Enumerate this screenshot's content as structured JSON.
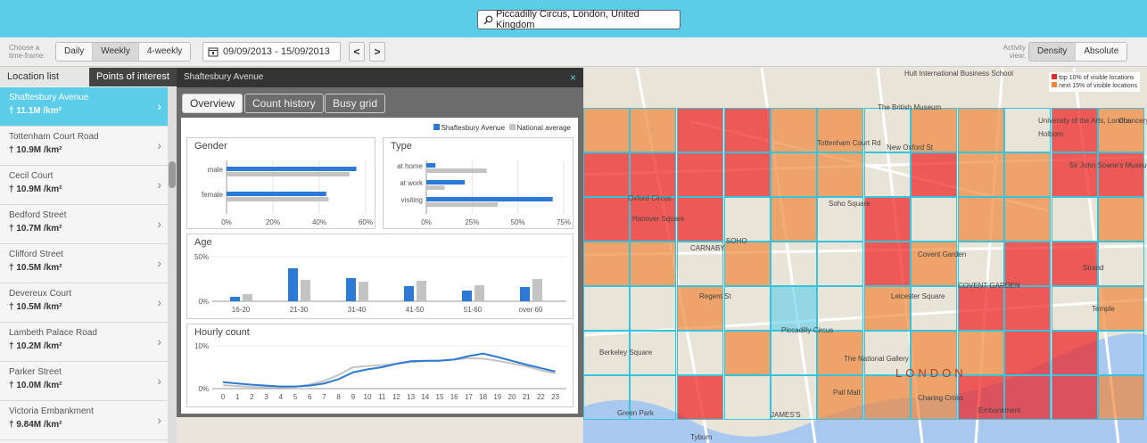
{
  "search": {
    "value": "Piccadilly Circus, London, United Kingdom"
  },
  "toolbar": {
    "timeframe_label": "Choose a time-frame:",
    "timeframes": [
      "Daily",
      "Weekly",
      "4-weekly"
    ],
    "selected_timeframe": "Weekly",
    "date_range": "09/09/2013 - 15/09/2013",
    "prev": "<",
    "next": ">",
    "activity_label": "Activity view:",
    "views": [
      "Density",
      "Absolute"
    ],
    "selected_view": "Density"
  },
  "sidebar": {
    "tabs": [
      "Location list",
      "Points of interest"
    ],
    "items": [
      {
        "name": "Shaftesbury Avenue",
        "value": "11.1M"
      },
      {
        "name": "Tottenham Court Road",
        "value": "10.9M"
      },
      {
        "name": "Cecil Court",
        "value": "10.9M"
      },
      {
        "name": "Bedford Street",
        "value": "10.7M"
      },
      {
        "name": "Clifford Street",
        "value": "10.5M"
      },
      {
        "name": "Devereux Court",
        "value": "10.5M"
      },
      {
        "name": "Lambeth Palace Road",
        "value": "10.2M"
      },
      {
        "name": "Parker Street",
        "value": "10.0M"
      },
      {
        "name": "Victoria Embankment",
        "value": "9.84M"
      }
    ],
    "unit": "/km²"
  },
  "panel": {
    "title": "Shaftesbury Avenue",
    "close": "×",
    "tabs": [
      "Overview",
      "Count history",
      "Busy grid"
    ],
    "legend_series": "Shaftesbury Avenue",
    "legend_national": "National average"
  },
  "chart_data": [
    {
      "type": "bar",
      "title": "Gender",
      "categories": [
        "male",
        "female"
      ],
      "series": [
        {
          "name": "Shaftesbury Avenue",
          "values": [
            56,
            43
          ]
        },
        {
          "name": "National average",
          "values": [
            53,
            44
          ]
        }
      ],
      "xticks": [
        "0%",
        "20%",
        "40%",
        "60%"
      ],
      "xlim": [
        0,
        60
      ]
    },
    {
      "type": "bar",
      "title": "Type",
      "categories": [
        "at home",
        "at work",
        "visiting"
      ],
      "series": [
        {
          "name": "Shaftesbury Avenue",
          "values": [
            5,
            21,
            69
          ]
        },
        {
          "name": "National average",
          "values": [
            33,
            10,
            39
          ]
        }
      ],
      "xticks": [
        "0%",
        "25%",
        "50%",
        "75%"
      ],
      "xlim": [
        0,
        75
      ]
    },
    {
      "type": "bar",
      "title": "Age",
      "categories": [
        "16-20",
        "21-30",
        "31-40",
        "41-50",
        "51-60",
        "over 60"
      ],
      "series": [
        {
          "name": "Shaftesbury Avenue",
          "values": [
            5,
            37,
            26,
            17,
            12,
            16
          ]
        },
        {
          "name": "National average",
          "values": [
            8,
            24,
            22,
            23,
            18,
            25
          ]
        }
      ],
      "yticks": [
        "50%",
        "0%"
      ],
      "ylim": [
        0,
        50
      ]
    },
    {
      "type": "line",
      "title": "Hourly count",
      "x": [
        0,
        1,
        2,
        3,
        4,
        5,
        6,
        7,
        8,
        9,
        10,
        11,
        12,
        13,
        14,
        15,
        16,
        17,
        18,
        19,
        20,
        21,
        22,
        23
      ],
      "series": [
        {
          "name": "Shaftesbury Avenue",
          "values": [
            1.5,
            1.2,
            0.9,
            0.7,
            0.5,
            0.5,
            0.7,
            1.2,
            2.2,
            3.8,
            4.5,
            5,
            5.8,
            6.4,
            6.5,
            6.5,
            6.8,
            7.6,
            8.2,
            7.4,
            6.5,
            5.6,
            4.8,
            4.0
          ]
        },
        {
          "name": "National average",
          "values": [
            0.8,
            0.6,
            0.4,
            0.3,
            0.3,
            0.4,
            1,
            1.8,
            3.2,
            5,
            5.3,
            5.5,
            5.8,
            6.2,
            6.4,
            6.6,
            6.8,
            7.1,
            7.0,
            6.5,
            5.9,
            5.2,
            4.3,
            3.6
          ]
        }
      ],
      "yticks": [
        "10%",
        "0%"
      ],
      "ylim": [
        0,
        10
      ]
    }
  ],
  "map": {
    "legend": [
      "top 10% of visible locations",
      "next 15% of visible locations"
    ],
    "colors": {
      "red": "#ee2b2b",
      "orange": "#f0883c",
      "blue": "#5ccde9"
    },
    "labels": [
      "Hult International Business School",
      "The British Museum",
      "Tottenham Court Rd",
      "New Oxford St",
      "Holborn",
      "University of the Arts, London",
      "Chancery Lane",
      "Sir John Soane's Museum",
      "Oxford Circus",
      "Hanover Square",
      "Soho Square",
      "SOHO",
      "CARNABY",
      "Covent Garden",
      "Leicester Square",
      "Piccadilly Circus",
      "Berkeley Square",
      "The National Gallery",
      "LONDON",
      "Charing Cross",
      "Embankment",
      "Green Park",
      "Temple",
      "Strand",
      "Regent St",
      "Pall Mall",
      "Tyburn",
      "JAMES'S",
      "COVENT GARDEN"
    ]
  }
}
